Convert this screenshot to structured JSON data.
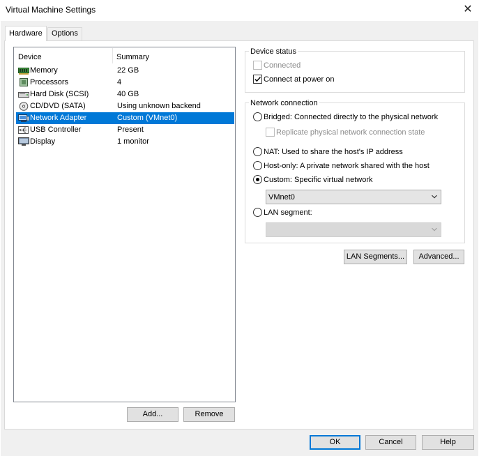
{
  "window": {
    "title": "Virtual Machine Settings",
    "close_glyph": "✕"
  },
  "tabs": [
    {
      "label": "Hardware",
      "active": true
    },
    {
      "label": "Options",
      "active": false
    }
  ],
  "device_list": {
    "columns": {
      "device": "Device",
      "summary": "Summary"
    },
    "rows": [
      {
        "name": "Memory",
        "summary": "22 GB",
        "icon": "memory-icon"
      },
      {
        "name": "Processors",
        "summary": "4",
        "icon": "processor-icon"
      },
      {
        "name": "Hard Disk (SCSI)",
        "summary": "40 GB",
        "icon": "hard-disk-icon"
      },
      {
        "name": "CD/DVD (SATA)",
        "summary": "Using unknown backend",
        "icon": "cd-dvd-icon"
      },
      {
        "name": "Network Adapter",
        "summary": "Custom (VMnet0)",
        "icon": "network-adapter-icon",
        "selected": true
      },
      {
        "name": "USB Controller",
        "summary": "Present",
        "icon": "usb-icon"
      },
      {
        "name": "Display",
        "summary": "1 monitor",
        "icon": "display-icon"
      }
    ]
  },
  "list_buttons": {
    "add": "Add...",
    "remove": "Remove"
  },
  "device_status": {
    "title": "Device status",
    "connected": {
      "label": "Connected",
      "checked": false,
      "enabled": false
    },
    "connect_at_power_on": {
      "label": "Connect at power on",
      "checked": true
    }
  },
  "network_connection": {
    "title": "Network connection",
    "bridged": {
      "label": "Bridged: Connected directly to the physical network",
      "selected": false
    },
    "replicate": {
      "label": "Replicate physical network connection state",
      "checked": false,
      "enabled": false
    },
    "nat": {
      "label": "NAT: Used to share the host's IP address",
      "selected": false
    },
    "host_only": {
      "label": "Host-only: A private network shared with the host",
      "selected": false
    },
    "custom": {
      "label": "Custom: Specific virtual network",
      "selected": true
    },
    "custom_network_value": "VMnet0",
    "lan_segment": {
      "label": "LAN segment:",
      "selected": false
    },
    "lan_segment_value": ""
  },
  "network_buttons": {
    "lan_segments": "LAN Segments...",
    "advanced": "Advanced..."
  },
  "dialog_buttons": {
    "ok": "OK",
    "cancel": "Cancel",
    "help": "Help"
  },
  "colors": {
    "selection": "#0078d7",
    "default_button_border": "#0078d7",
    "client_bg": "#f0f0f0"
  }
}
